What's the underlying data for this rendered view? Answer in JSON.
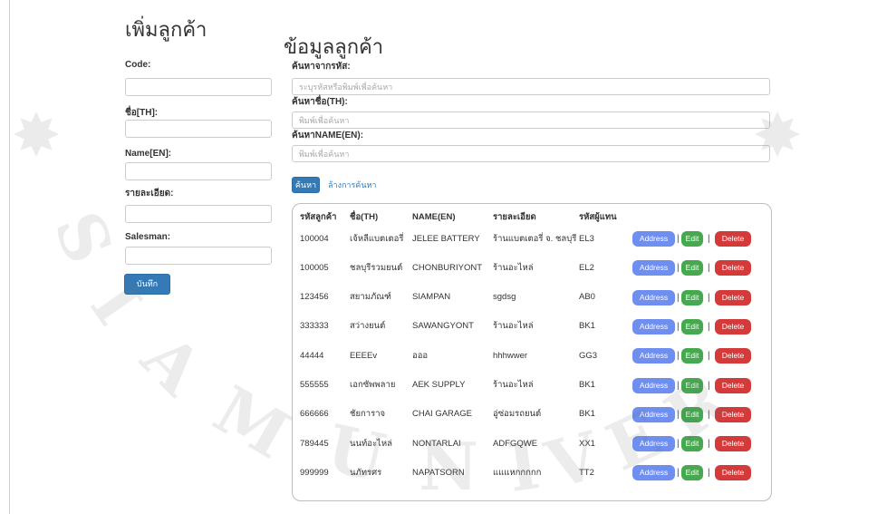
{
  "add_customer": {
    "heading": "เพิ่มลูกค้า",
    "fields": [
      {
        "label": "Code:",
        "value": ""
      },
      {
        "label": "ชื่อ[TH]:",
        "value": ""
      },
      {
        "label": "Name[EN]:",
        "value": ""
      },
      {
        "label": "รายละเอียด:",
        "value": ""
      },
      {
        "label": "Salesman:",
        "value": ""
      }
    ],
    "save_label": "บันทึก"
  },
  "customer_data": {
    "heading": "ข้อมูลลูกค้า",
    "search": {
      "code": {
        "label": "ค้นหาจากรหัส:",
        "placeholder": "ระบุรหัสหรือพิมพ์เพื่อค้นหา",
        "value": ""
      },
      "name_th": {
        "label": "ค้นหาชื่อ(TH):",
        "placeholder": "พิมพ์เพื่อค้นหา",
        "value": ""
      },
      "name_en": {
        "label": "ค้นหาNAME(EN):",
        "placeholder": "พิมพ์เพื่อค้นหา",
        "value": ""
      },
      "search_label": "ค้นหา",
      "clear_label": "ล้างการค้นหา"
    },
    "table": {
      "columns": [
        "รหัสลูกค้า",
        "ชื่อ(TH)",
        "NAME(EN)",
        "รายละเอียด",
        "รหัสผู้แทน"
      ],
      "actions": {
        "address": "Address",
        "edit": "Edit",
        "delete": "Delete",
        "separator": "|"
      },
      "rows": [
        {
          "code": "100004",
          "name_th": "เจ้หลีแบตเตอรี่",
          "name_en": "JELEE BATTERY",
          "detail": "ร้านแบตเตอรี่ จ. ชลบุรี",
          "salesman": "EL3"
        },
        {
          "code": "100005",
          "name_th": "ชลบุรีรวมยนต์",
          "name_en": "CHONBURIYONT",
          "detail": "ร้านอะไหล่",
          "salesman": "EL2"
        },
        {
          "code": "123456",
          "name_th": "สยามภัณฑ์",
          "name_en": "SIAMPAN",
          "detail": "sgdsg",
          "salesman": "AB0"
        },
        {
          "code": "333333",
          "name_th": "สว่างยนต์",
          "name_en": "SAWANGYONT",
          "detail": "ร้านอะไหล่",
          "salesman": "BK1"
        },
        {
          "code": "44444",
          "name_th": "EEEEv",
          "name_en": "อออ",
          "detail": "hhhwwer",
          "salesman": "GG3"
        },
        {
          "code": "555555",
          "name_th": "เอกซัพพลาย",
          "name_en": "AEK SUPPLY",
          "detail": "ร้านอะไหล่",
          "salesman": "BK1"
        },
        {
          "code": "666666",
          "name_th": "ชัยการาจ",
          "name_en": "CHAI GARAGE",
          "detail": "อู่ซ่อมรถยนต์",
          "salesman": "BK1"
        },
        {
          "code": "789445",
          "name_th": "นนท์อะไหล่",
          "name_en": "NONTARLAI",
          "detail": "ADFGQWE",
          "salesman": "XX1"
        },
        {
          "code": "999999",
          "name_th": "นภัทรศร",
          "name_en": "NAPATSORN",
          "detail": "แแแหกกกกก",
          "salesman": "TT2"
        }
      ]
    }
  },
  "colors": {
    "primary": "#337ab7",
    "address": "#6e8ef0",
    "edit": "#46a84f",
    "delete": "#d43a3a"
  },
  "watermark": {
    "seal_letters": "SIAM UNIVER",
    "emblem_icon": "star-emblem-icon"
  }
}
